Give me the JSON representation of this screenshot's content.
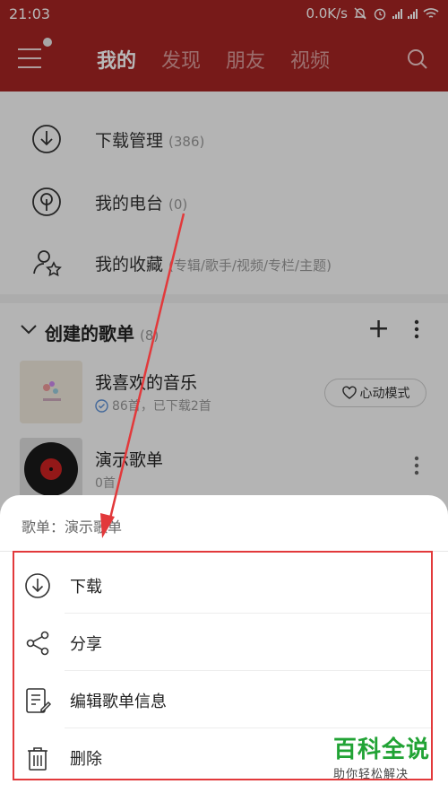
{
  "status": {
    "time": "21:03",
    "speed": "0.0K/s"
  },
  "tabs": [
    "我的",
    "发现",
    "朋友",
    "视频"
  ],
  "entries": [
    {
      "label": "下载管理",
      "count": "(386)",
      "icon": "download-icon"
    },
    {
      "label": "我的电台",
      "count": "(0)",
      "icon": "radio-icon"
    },
    {
      "label": "我的收藏",
      "count": "(专辑/歌手/视频/专栏/主题)",
      "icon": "collection-icon"
    }
  ],
  "section": {
    "title": "创建的歌单",
    "count": "(8)"
  },
  "playlists": [
    {
      "name": "我喜欢的音乐",
      "meta": "86首，已下载2首",
      "button": "心动模式"
    },
    {
      "name": "演示歌单",
      "meta": "0首"
    }
  ],
  "sheet": {
    "title": "歌单：演示歌单",
    "items": [
      {
        "label": "下载",
        "icon": "download-icon"
      },
      {
        "label": "分享",
        "icon": "share-icon"
      },
      {
        "label": "编辑歌单信息",
        "icon": "edit-info-icon"
      },
      {
        "label": "删除",
        "icon": "trash-icon"
      }
    ]
  },
  "watermark": {
    "main": "百科全说",
    "sub": "助你轻松解决"
  },
  "colors": {
    "brand": "#a52523",
    "highlight": "#e2393b",
    "watermark": "#21a335"
  }
}
